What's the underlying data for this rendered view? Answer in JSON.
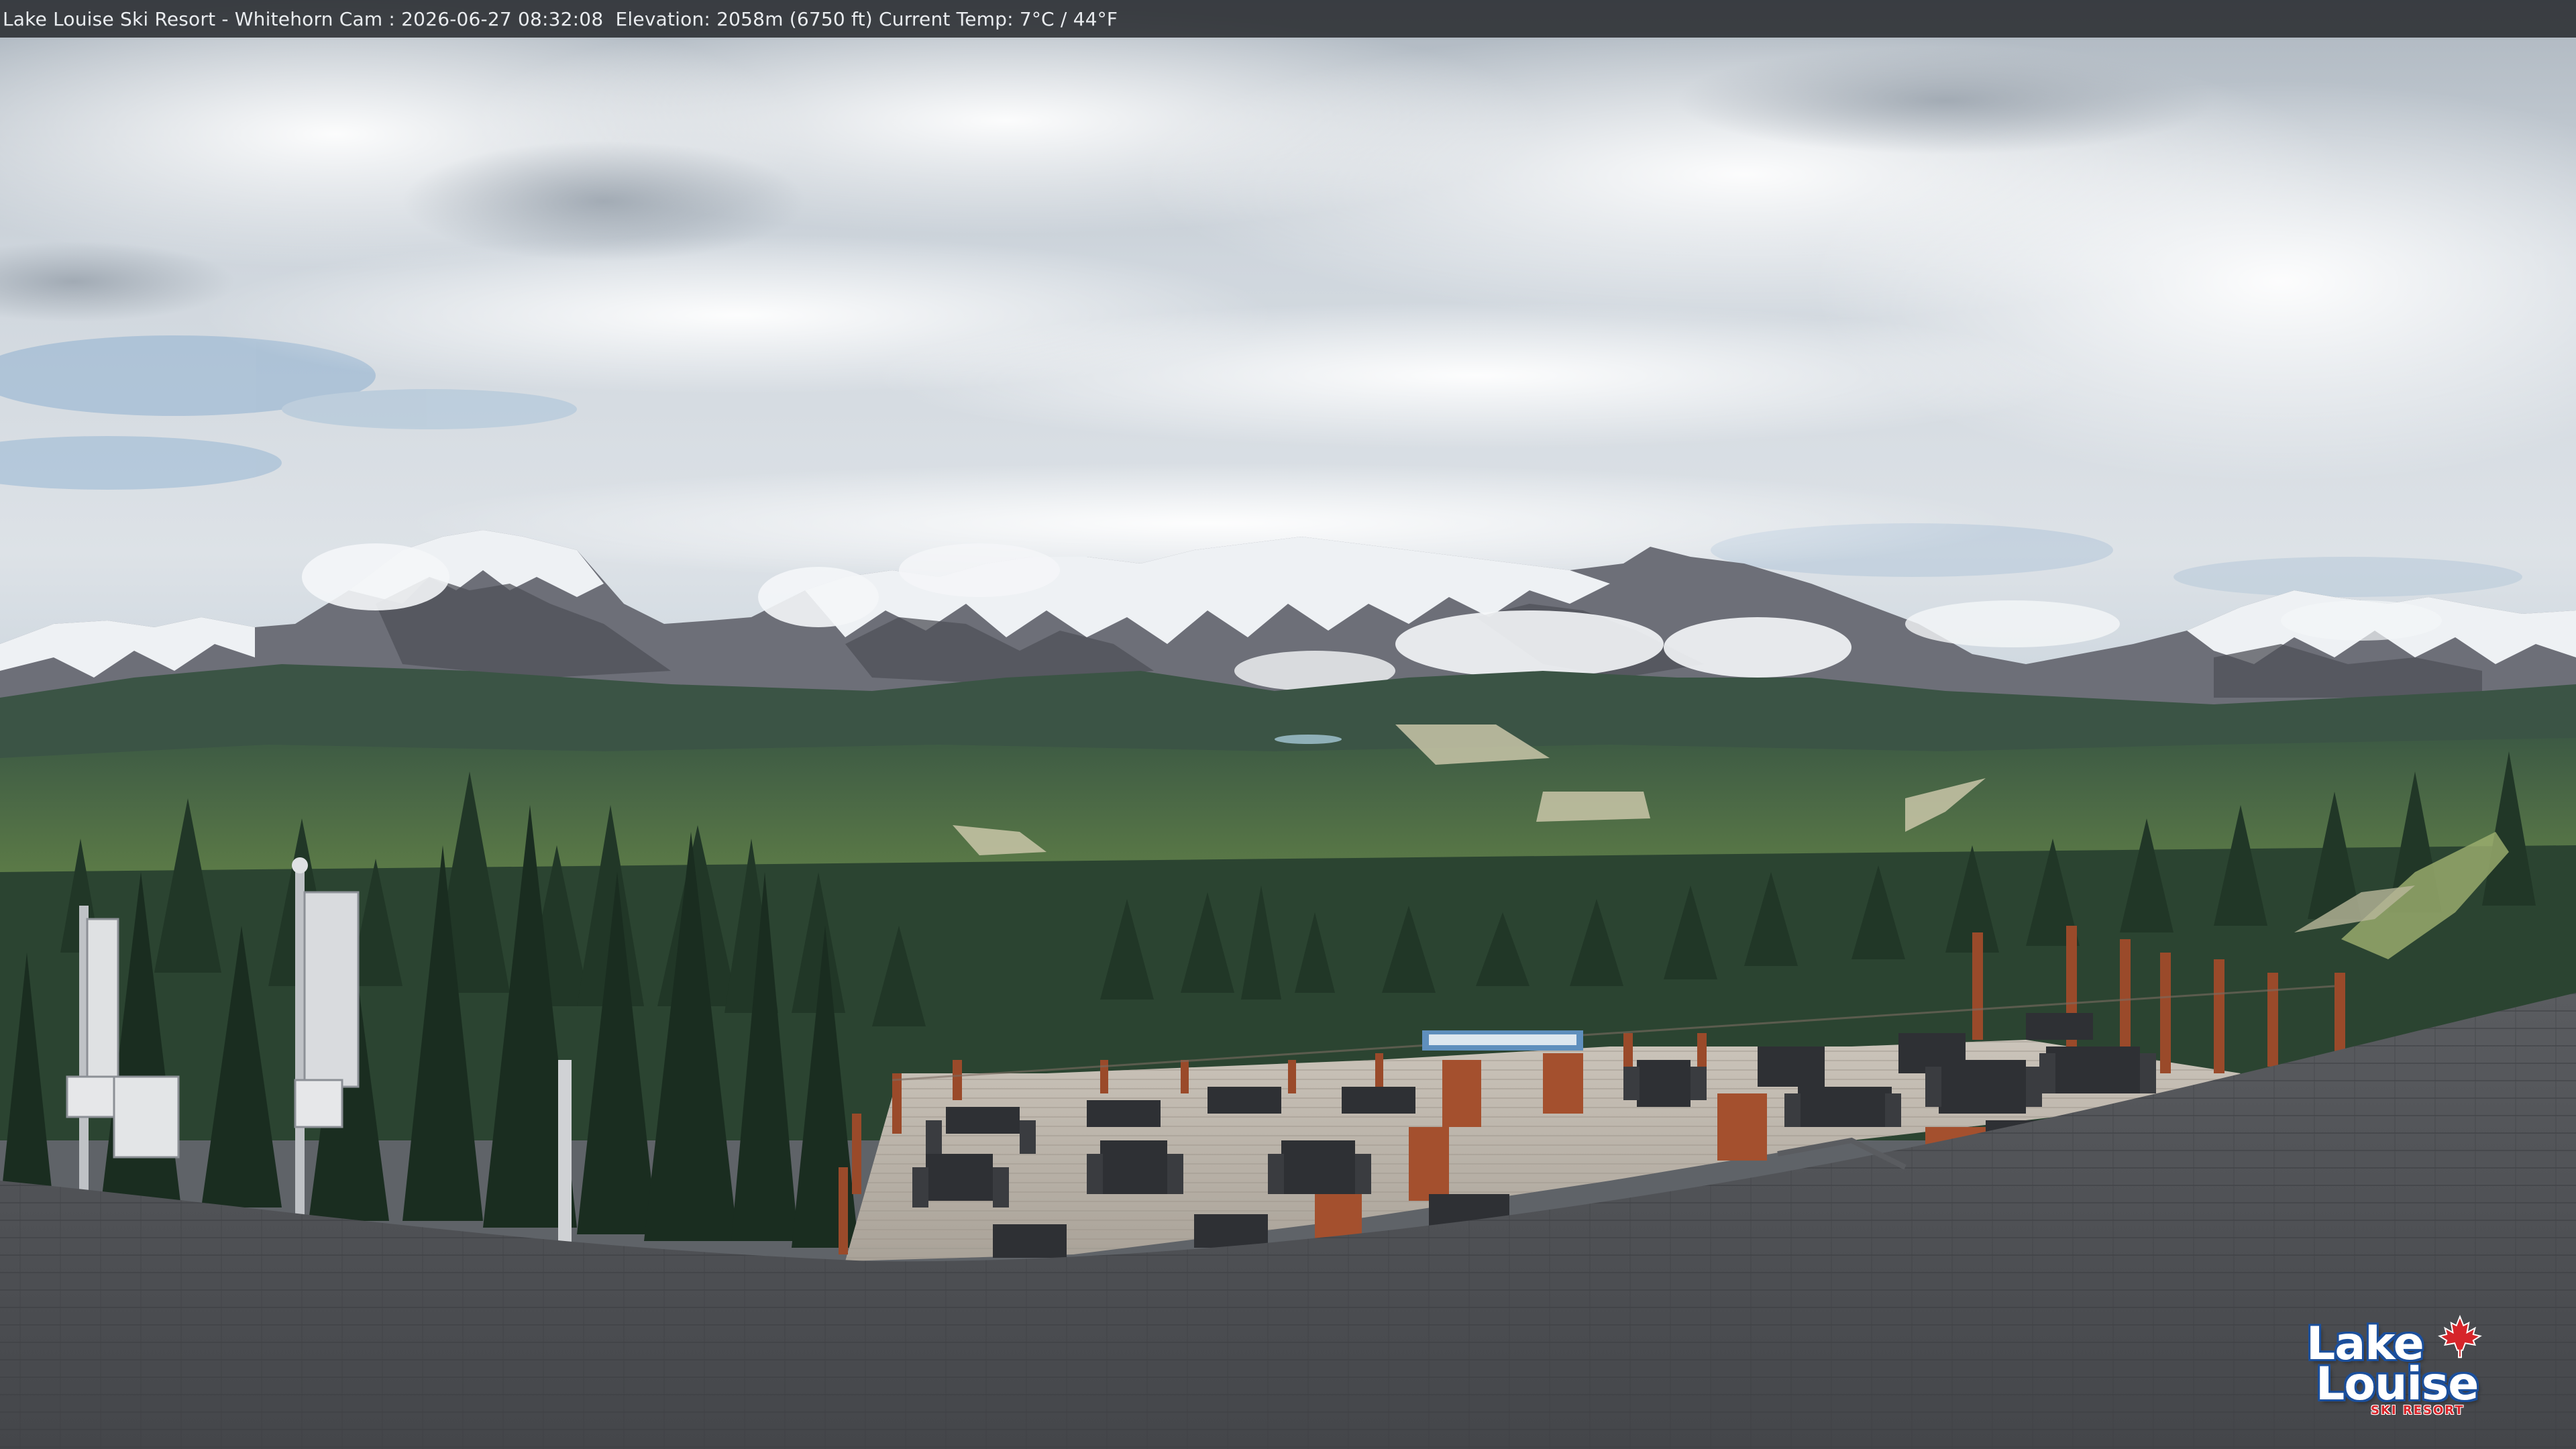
{
  "camera": {
    "title": "Lake Louise Ski Resort - Whitehorn Cam : 2026-06-27 08:32:08  Elevation: 2058m (6750 ft) Current Temp: 7°C / 44°F"
  },
  "logo": {
    "line1": "Lake",
    "line2": "Louise",
    "tagline": "SKI RESORT",
    "icon": "maple-leaf-icon",
    "accent_color": "#d6252a",
    "outline_color": "#1b4f9c"
  },
  "sign": {
    "icon": "panorama-sign"
  },
  "palette": {
    "sky": "#c9d2db",
    "snow": "#eef1f4",
    "forest": "#2f4a32",
    "valley": "#5f7a48",
    "deck": "#bfb8ad",
    "roof": "#4e5054",
    "planter": "#a4502e"
  }
}
